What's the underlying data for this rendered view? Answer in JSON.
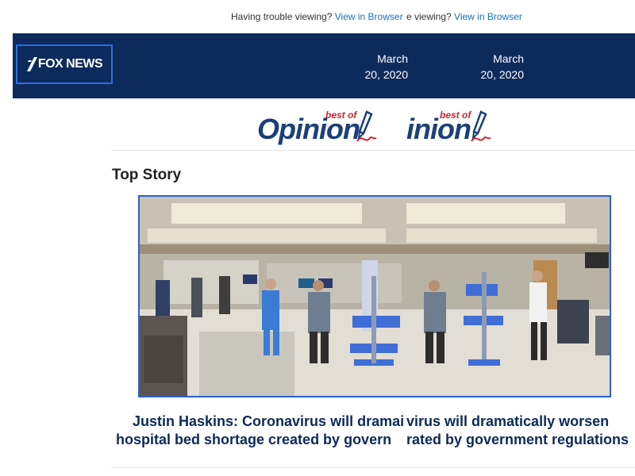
{
  "preheader": {
    "text": "Having trouble viewing?",
    "link": "View in Browser",
    "right_fragment": "e viewing?"
  },
  "header": {
    "logo_text": "FOX NEWS",
    "date_left": "March 20, 2020",
    "date_right": "March 20, 2020"
  },
  "opinion_banner": {
    "best_of": "best of",
    "word_left": "Opinion",
    "word_right": "inion"
  },
  "section": {
    "title": "Top Story"
  },
  "story": {
    "headline_line1_left": "Justin Haskins: Coronavirus will dramai",
    "headline_line2_left": "hospital bed shortage created by govern",
    "headline_line1_right": "virus will dramatically worsen",
    "headline_line2_right": "rated by government regulations"
  },
  "colors": {
    "header_bg": "#0d2a5c",
    "link": "#1a6fc4",
    "headline": "#0d2a5c",
    "opinion_blue": "#1b3f7a",
    "opinion_red": "#d0232b",
    "photo_border": "#2f62c8"
  }
}
